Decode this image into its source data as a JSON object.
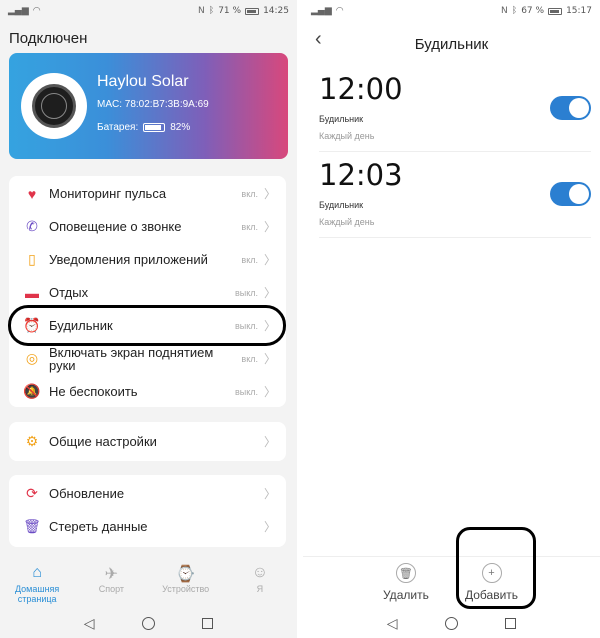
{
  "left": {
    "status": {
      "battery": "71 %",
      "time": "14:25"
    },
    "connected_title": "Подключен",
    "device": {
      "name": "Haylou Solar",
      "mac": "MAC: 78:02:B7:3B:9A:69",
      "battery_label": "Батарея:",
      "battery_value": "82%"
    },
    "settings": [
      {
        "label": "Мониторинг пульса",
        "state": "вкл.",
        "icon": "heart-icon",
        "color": "#e0344a"
      },
      {
        "label": "Оповещение о звонке",
        "state": "вкл.",
        "icon": "phone-icon",
        "color": "#6b4cc4"
      },
      {
        "label": "Уведомления приложений",
        "state": "вкл.",
        "icon": "phone-notification-icon",
        "color": "#f2a31c"
      },
      {
        "label": "Отдых",
        "state": "выкл.",
        "icon": "sofa-icon",
        "color": "#e0344a"
      },
      {
        "label": "Будильник",
        "state": "выкл.",
        "icon": "alarm-clock-icon",
        "color": "#e0344a"
      },
      {
        "label": "Включать экран поднятием руки",
        "state": "вкл.",
        "icon": "raise-hand-icon",
        "color": "#f2a31c"
      },
      {
        "label": "Не беспокоить",
        "state": "выкл.",
        "icon": "bell-off-icon",
        "color": "#6b4cc4"
      }
    ],
    "general": {
      "label": "Общие настройки",
      "icon": "gear-icon"
    },
    "maintenance": [
      {
        "label": "Обновление",
        "icon": "refresh-icon"
      },
      {
        "label": "Стереть данные",
        "icon": "trash-icon"
      }
    ],
    "tabs": [
      {
        "label": "Домашняя страница",
        "icon": "home-icon",
        "active": true
      },
      {
        "label": "Спорт",
        "icon": "run-icon",
        "active": false
      },
      {
        "label": "Устройство",
        "icon": "band-icon",
        "active": false
      },
      {
        "label": "Я",
        "icon": "person-icon",
        "active": false
      }
    ]
  },
  "right": {
    "status": {
      "battery": "67 %",
      "time": "15:17"
    },
    "title": "Будильник",
    "alarms": [
      {
        "time": "12:00",
        "name": "Будильник",
        "repeat": "Каждый день",
        "enabled": true
      },
      {
        "time": "12:03",
        "name": "Будильник",
        "repeat": "Каждый день",
        "enabled": true
      }
    ],
    "actions": {
      "delete": "Удалить",
      "add": "Добавить"
    }
  },
  "colors": {
    "accent": "#2b7fd1",
    "tab_active": "#2b8fd6"
  }
}
